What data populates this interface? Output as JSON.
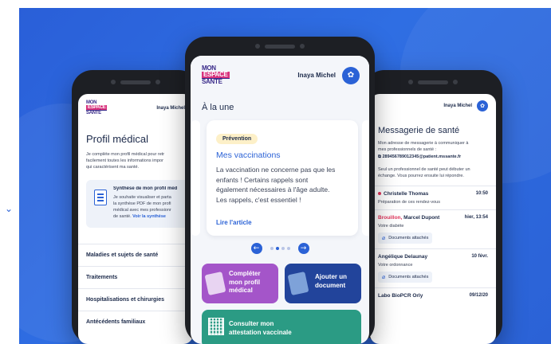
{
  "colors": {
    "background": "#2b62d6",
    "accent": "#2b62d6",
    "brand_pink": "#d8327c",
    "brand_purple": "#3a2b8a",
    "tile_purple": "#a455c9",
    "tile_navy": "#22449b",
    "tile_green": "#2b9b84",
    "alert_red": "#e0335a"
  },
  "brand": {
    "line1": "MON",
    "line2": "ESPACE",
    "line3": "SANTÉ"
  },
  "user": {
    "name": "Inaya Michel",
    "avatar_icon": "user-group-icon"
  },
  "left_phone": {
    "title": "Profil médical",
    "intro_lines": [
      "Je complète mon profil médical pour retr",
      "facilement toutes les informations impor",
      "qui caractérisent ma santé."
    ],
    "synthesis_card": {
      "icon": "document-icon",
      "title": "Synthèse de mon profil méd",
      "desc_lines": [
        "Je souhaite visualiser et parta",
        "la synthèse PDF de mon profi",
        "médical avec mes professionr",
        "de santé."
      ],
      "link": "Voir la synthèse"
    },
    "list": [
      "Maladies et sujets de santé",
      "Traitements",
      "Hospitalisations et chirurgies",
      "Antécédents familiaux"
    ]
  },
  "center_phone": {
    "section_title": "À la une",
    "card": {
      "badge": "Prévention",
      "title": "Mes vaccinations",
      "body_lines": [
        "La vaccination ne concerne pas que les",
        "enfants ! Certains rappels sont",
        "également nécessaires à l'âge adulte.",
        "Les rappels, c'est essentiel !"
      ],
      "link": "Lire l'article"
    },
    "pager": {
      "prev_icon": "arrow-left-icon",
      "next_icon": "arrow-right-icon",
      "active_page": 2,
      "pages": 4
    },
    "tiles": [
      {
        "line1": "Compléter",
        "line2": "mon profil",
        "line3": "médical",
        "icon": "medical-form-icon"
      },
      {
        "line1": "Ajouter un",
        "line2": "document",
        "line3": "",
        "icon": "document-upload-icon"
      }
    ],
    "wide_tile": {
      "line1": "Consulter mon",
      "line2": "attestation vaccinale",
      "icon": "qr-code-icon"
    }
  },
  "right_phone": {
    "title": "Messagerie de santé",
    "address_intro_lines": [
      "Mon adresse de messagerie à communiquer à",
      "mes professionnels de santé :"
    ],
    "address": "289456789012345@patient.mssante.fr",
    "note_lines": [
      "Seul un professionnel de santé peut débuter un",
      "échange. Vous pourrez ensuite lui répondre."
    ],
    "messages": [
      {
        "sender": "Christelle Thomas",
        "prefix": "",
        "time": "10:50",
        "subject": "Préparation de ces rendez-vous",
        "attachment": "",
        "unread": true
      },
      {
        "sender": "Marcel Dupont",
        "prefix": "Brouillon,",
        "time": "hier, 13:54",
        "subject": "Votre diabète",
        "attachment": "Documents attachés",
        "unread": false
      },
      {
        "sender": "Angélique Delaunay",
        "prefix": "",
        "time": "10 févr.",
        "subject": "Votre ordonnance",
        "attachment": "Documents attachés",
        "unread": false
      },
      {
        "sender": "Labo BioPCR Orly",
        "prefix": "",
        "time": "09/12/20",
        "subject": "",
        "attachment": "",
        "unread": false
      }
    ]
  }
}
